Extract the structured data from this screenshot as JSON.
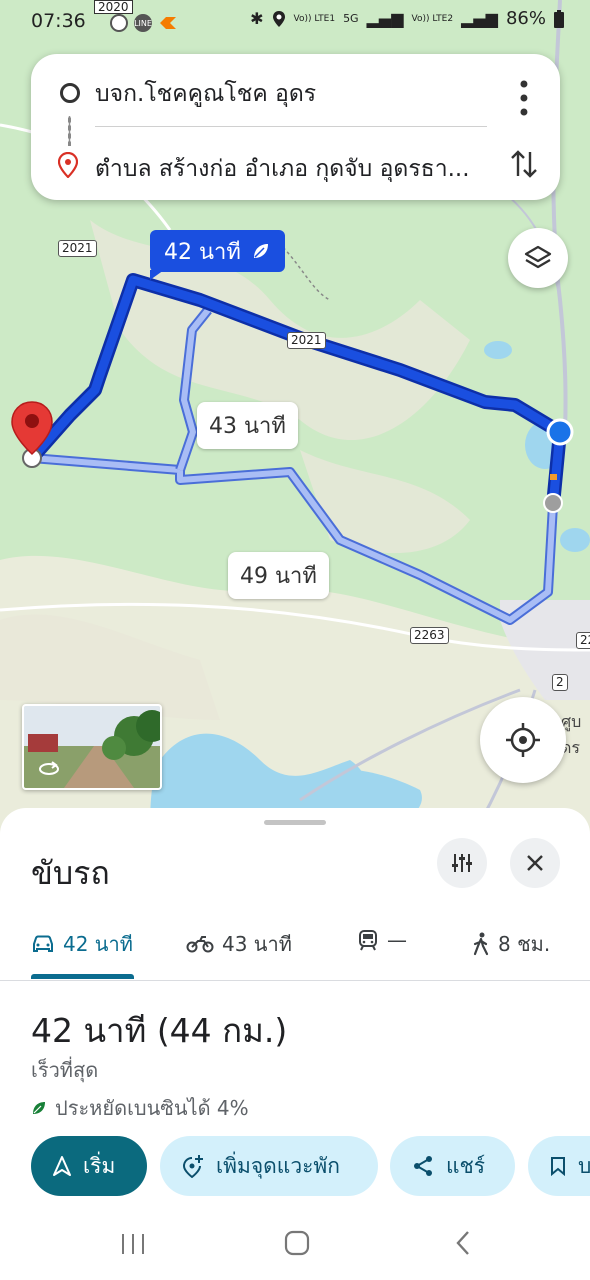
{
  "status_bar": {
    "time": "07:36",
    "badge_2020": "2020",
    "line_label": "LINE",
    "signal1": "Vo)) LTE1",
    "net5g": "5G",
    "signal2": "Vo)) LTE2",
    "battery": "86%"
  },
  "route": {
    "origin": "บจก.โชคคูณโชค อุดร",
    "destination": "ตำบล สร้างก่อ อำเภอ กุดจับ อุดรธา..."
  },
  "map": {
    "primary_route_label": "42 นาที",
    "alt_route_1_label": "43 นาที",
    "alt_route_2_label": "49 นาที",
    "road_2021_a": "2021",
    "road_2021_b": "2021",
    "road_2263": "2263",
    "road_2": "2",
    "road_22": "22",
    "edge_text": "ศูบ",
    "edge_text2": "ดร"
  },
  "sheet": {
    "mode_title": "ขับรถ",
    "tabs": [
      {
        "icon": "car-icon",
        "label": "42 นาที"
      },
      {
        "icon": "motorcycle-icon",
        "label": "43 นาที"
      },
      {
        "icon": "train-icon",
        "label": "—"
      },
      {
        "icon": "walk-icon",
        "label": "8 ชม."
      }
    ],
    "summary": "42 นาที (44 กม.)",
    "subtitle": "เร็วที่สุด",
    "eco_text": "ประหยัดเบนซินได้ 4%",
    "actions": {
      "start": "เริ่ม",
      "add_stop": "เพิ่มจุดแวะพัก",
      "share": "แชร์",
      "save": "บ"
    }
  },
  "colors": {
    "primary_route": "#1a4fe0",
    "alt_route": "#a9bdf5",
    "start_button": "#0b6a7e",
    "action_chip": "#d3f0fb",
    "accent": "#0b6c8f"
  }
}
